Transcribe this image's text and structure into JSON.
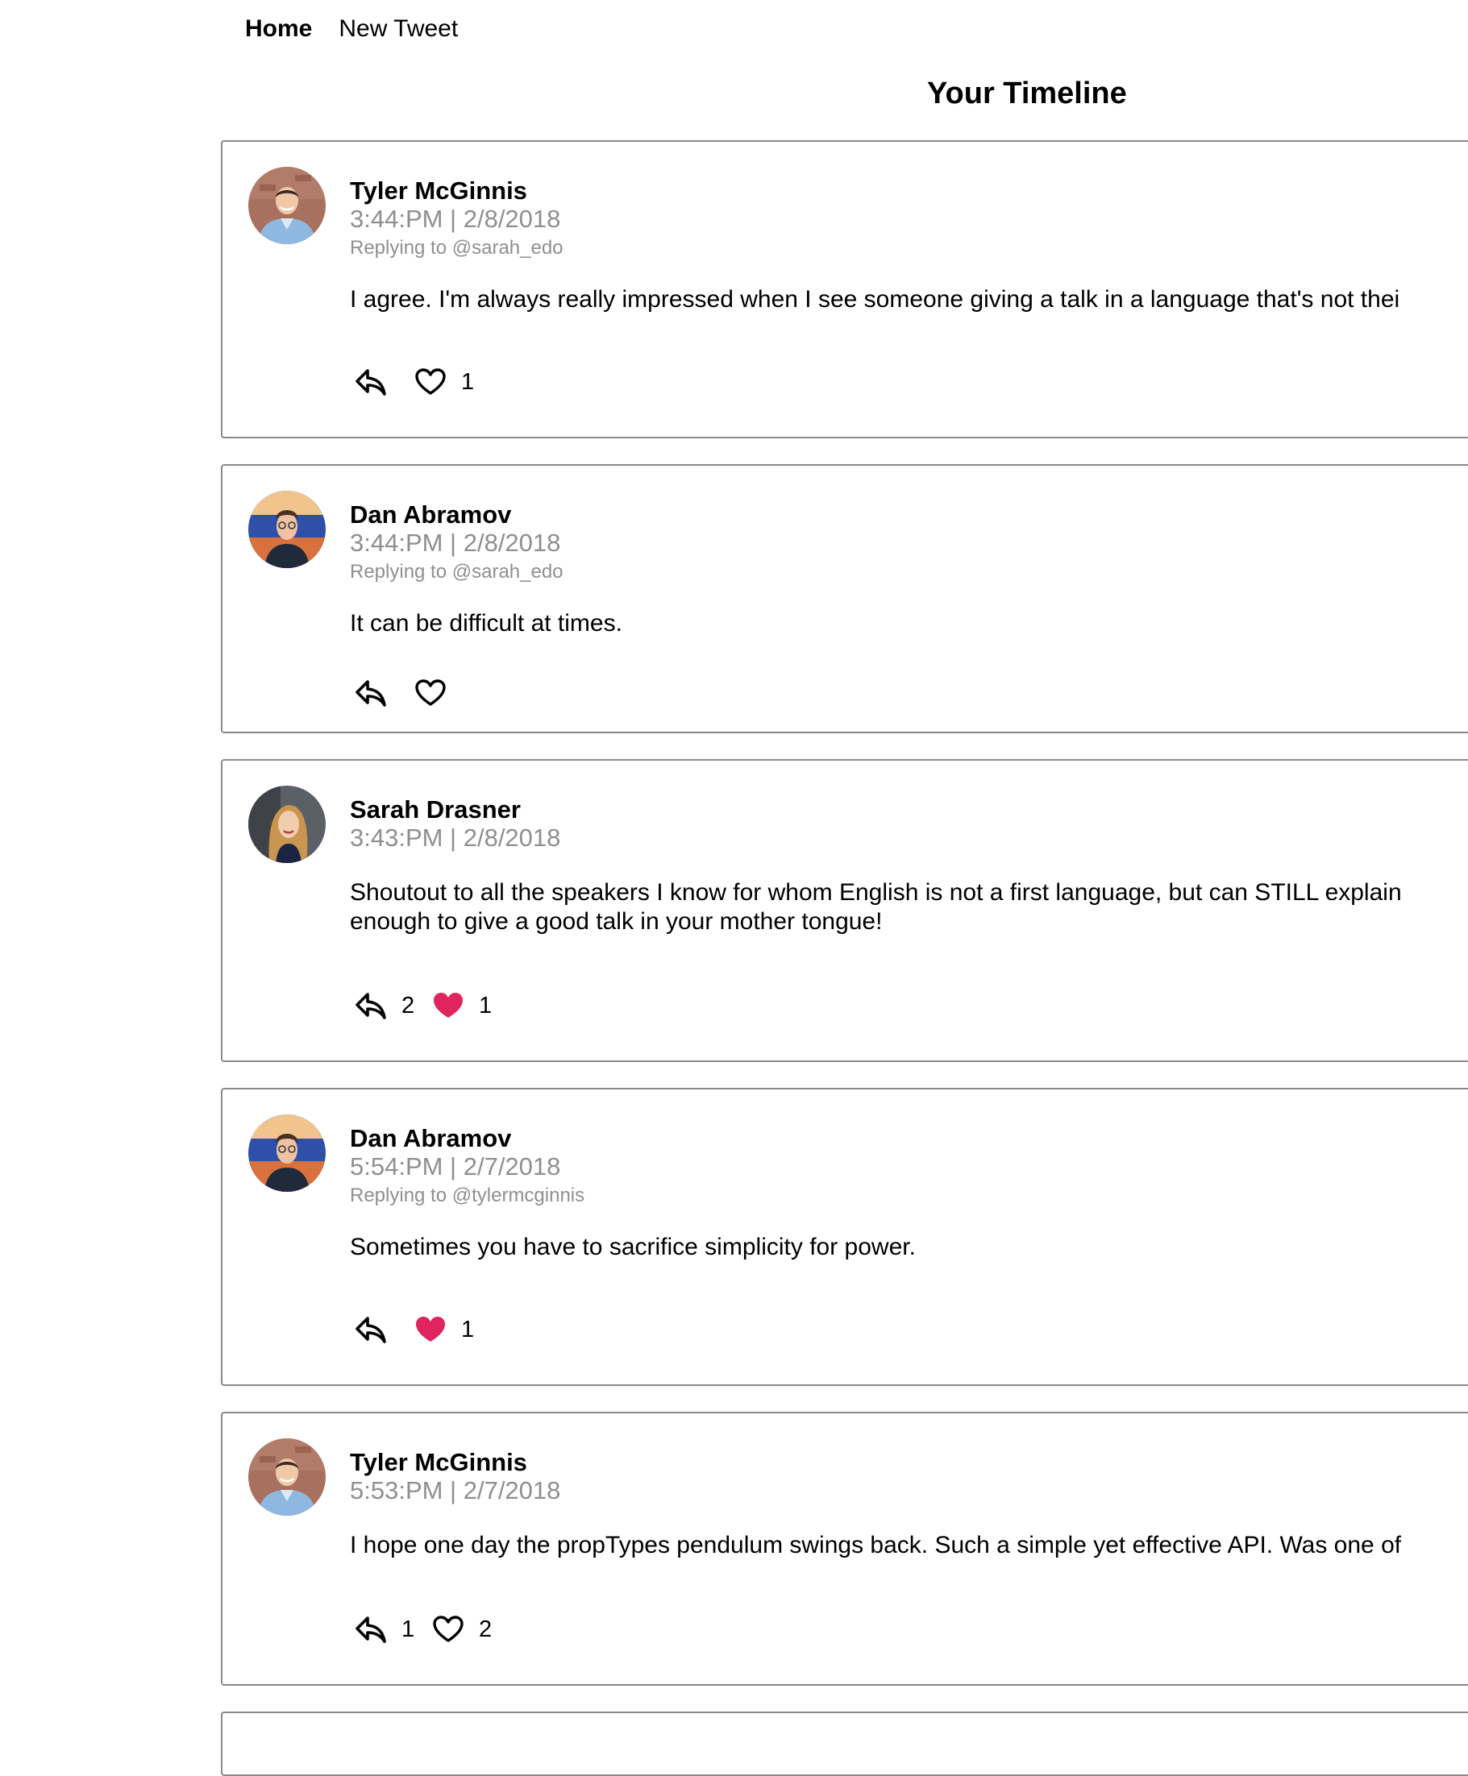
{
  "nav": {
    "home": "Home",
    "new_tweet": "New Tweet"
  },
  "page_title": "Your Timeline",
  "colors": {
    "liked_heart": "#e0245e",
    "meta_gray": "#8f8f8f",
    "border": "#8a8a8a"
  },
  "tweets": [
    {
      "author": "Tyler McGinnis",
      "timestamp": "3:44:PM | 2/8/2018",
      "replying_to": "Replying to @sarah_edo",
      "text": "I agree. I'm always really impressed when I see someone giving a talk in a language that's not thei",
      "replies": "",
      "likes": "1",
      "liked": false,
      "avatar": "tyler-avatar"
    },
    {
      "author": "Dan Abramov",
      "timestamp": "3:44:PM | 2/8/2018",
      "replying_to": "Replying to @sarah_edo",
      "text": "It can be difficult at times.",
      "replies": "",
      "likes": "",
      "liked": false,
      "avatar": "dan-avatar"
    },
    {
      "author": "Sarah Drasner",
      "timestamp": "3:43:PM | 2/8/2018",
      "replying_to": "",
      "text": "Shoutout to all the speakers I know for whom English is not a first language, but can STILL explain",
      "text_line2": "enough to give a good talk in your mother tongue!",
      "replies": "2",
      "likes": "1",
      "liked": true,
      "avatar": "sarah-avatar"
    },
    {
      "author": "Dan Abramov",
      "timestamp": "5:54:PM | 2/7/2018",
      "replying_to": "Replying to @tylermcginnis",
      "text": "Sometimes you have to sacrifice simplicity for power.",
      "replies": "",
      "likes": "1",
      "liked": true,
      "avatar": "dan-avatar"
    },
    {
      "author": "Tyler McGinnis",
      "timestamp": "5:53:PM | 2/7/2018",
      "replying_to": "",
      "text": "I hope one day the propTypes pendulum swings back. Such a simple yet effective API. Was one of",
      "replies": "1",
      "likes": "2",
      "liked": false,
      "avatar": "tyler-avatar"
    }
  ]
}
